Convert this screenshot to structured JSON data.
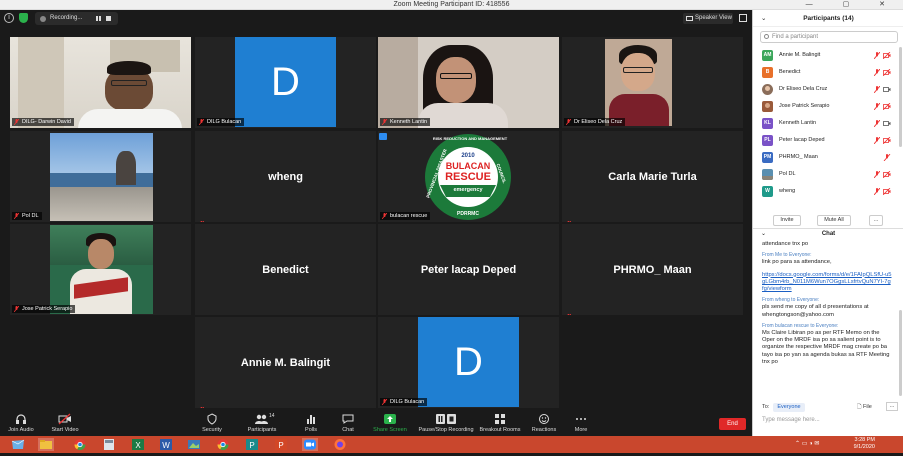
{
  "window": {
    "title": "Zoom Meeting Participant ID: 418556",
    "controls": "— ▢ ✕"
  },
  "topbar": {
    "recording_label": "Recording...",
    "speaker_view_label": "Speaker View"
  },
  "tiles": [
    {
      "name": "DILG- Darwin David",
      "kind": "photo",
      "active": true
    },
    {
      "name": "DILG Bulacan",
      "kind": "letter",
      "letter": "D"
    },
    {
      "name": "Kenneth Lantin",
      "kind": "photo"
    },
    {
      "name": "Dr Eliseo Dela Cruz",
      "kind": "photo"
    },
    {
      "name": "Pol DL",
      "kind": "photo"
    },
    {
      "name": "",
      "kind": "text",
      "big": "wheng"
    },
    {
      "name": "bulacan rescue",
      "kind": "logo"
    },
    {
      "name": "",
      "kind": "text",
      "big": "Carla Marie Turla"
    },
    {
      "name": "Jose Patrick Serapio",
      "kind": "photo"
    },
    {
      "name": "",
      "kind": "text",
      "big": "Benedict"
    },
    {
      "name": "",
      "kind": "text",
      "big": "Peter lacap Deped"
    },
    {
      "name": "",
      "kind": "text",
      "big": "PHRMO_ Maan"
    },
    {
      "name": "",
      "kind": "text",
      "big": "Annie M. Balingit"
    },
    {
      "name": "DILG Bulacan",
      "kind": "letter",
      "letter": "D"
    }
  ],
  "logo": {
    "year": "2010",
    "line1": "BULACAN",
    "line2": "RESCUE",
    "line3": "emergency",
    "ring_left": "PROVINCIAL DISASTER",
    "ring_top": "RISK REDUCTION AND MANAGEMENT",
    "ring_right": "COUNCIL",
    "bottom": "PDRRMC"
  },
  "toolbar": {
    "join_audio": "Join Audio",
    "start_video": "Start Video",
    "security": "Security",
    "participants": "Participants",
    "participants_count": "14",
    "polls": "Polls",
    "chat": "Chat",
    "share_screen": "Share Screen",
    "pause_recording": "Pause/Stop Recording",
    "breakout_rooms": "Breakout Rooms",
    "reactions": "Reactions",
    "more": "More",
    "end": "End"
  },
  "participants_panel": {
    "title": "Participants (14)",
    "search_placeholder": "Find a participant",
    "invite": "Invite",
    "mute_all": "Mute All",
    "more": "...",
    "list": [
      {
        "initials": "AM",
        "name": "Annie M. Balingit",
        "color": "#3aa65a"
      },
      {
        "initials": "B",
        "name": "Benedict",
        "color": "#e8702a"
      },
      {
        "initials": "",
        "name": "Dr Eliseo Dela Cruz",
        "color": "#8a6d5a"
      },
      {
        "initials": "",
        "name": "Jose Patrick Serapio",
        "color": "#9a5a3a"
      },
      {
        "initials": "KL",
        "name": "Kenneth Lantin",
        "color": "#7a52c7"
      },
      {
        "initials": "PL",
        "name": "Peter lacap Deped",
        "color": "#7a52c7"
      },
      {
        "initials": "PM",
        "name": "PHRMO_ Maan",
        "color": "#3a6bc2"
      },
      {
        "initials": "",
        "name": "Pol DL",
        "color": "#5a8fb0"
      },
      {
        "initials": "W",
        "name": "wheng",
        "color": "#1f9a8a"
      }
    ]
  },
  "chat_panel": {
    "title": "Chat",
    "messages": [
      {
        "from": "",
        "text": "attendance tnx po"
      },
      {
        "from": "From Me to Everyone:",
        "text": "link po para sa attendance,"
      },
      {
        "from": "",
        "link": "https://docs.google.com/forms/d/e/1FAIpQLSfU-u5gLGbm4rb_N011M6Wun7OGgsLLsfrtvQuN7YI-7gfg/viewform"
      },
      {
        "from": "From wheng to Everyone:",
        "text": "pls send me copy of all d presentations at whengtongson@yahoo.com"
      },
      {
        "from": "From bulacan rescue to Everyone:",
        "text": "Ms Claire Libiran po as per RTF Memo on the Oper on the MRDF isa po sa salient point is to organize the respective MRDF mag create po ba tayo  isa po yan sa agenda bukas sa RTF Meeting tnx po"
      }
    ],
    "to_label": "To:",
    "to_value": "Everyone",
    "file_label": "File",
    "more": "...",
    "placeholder": "Type message here..."
  },
  "taskbar": {
    "time": "3:28 PM",
    "date": "9/1/2020"
  },
  "colors": {
    "active_border": "#b9d94a",
    "letter_tile": "#1f7fd2",
    "end_button": "#e02828",
    "taskbar": "#c9472d",
    "share_green": "#2bb24c"
  }
}
